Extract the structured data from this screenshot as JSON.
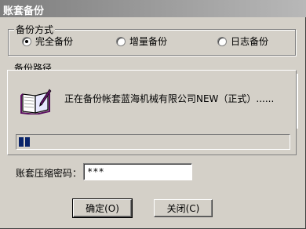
{
  "window": {
    "title": "账套备份"
  },
  "mode_group": {
    "legend": "备份方式",
    "options": [
      {
        "label": "完全备份",
        "selected": true
      },
      {
        "label": "增量备份",
        "selected": false
      },
      {
        "label": "日志备份",
        "selected": false
      }
    ]
  },
  "path_group": {
    "legend": "备份路径"
  },
  "progress": {
    "message": "正在备份帐套蓝海机械有限公司NEW（正式）......",
    "value_percent": 4,
    "icon": "book-icon"
  },
  "password": {
    "label": "账套压缩密码：",
    "value": "***"
  },
  "buttons": {
    "ok_label": "确定(O)",
    "close_label": "关闭(C)"
  }
}
